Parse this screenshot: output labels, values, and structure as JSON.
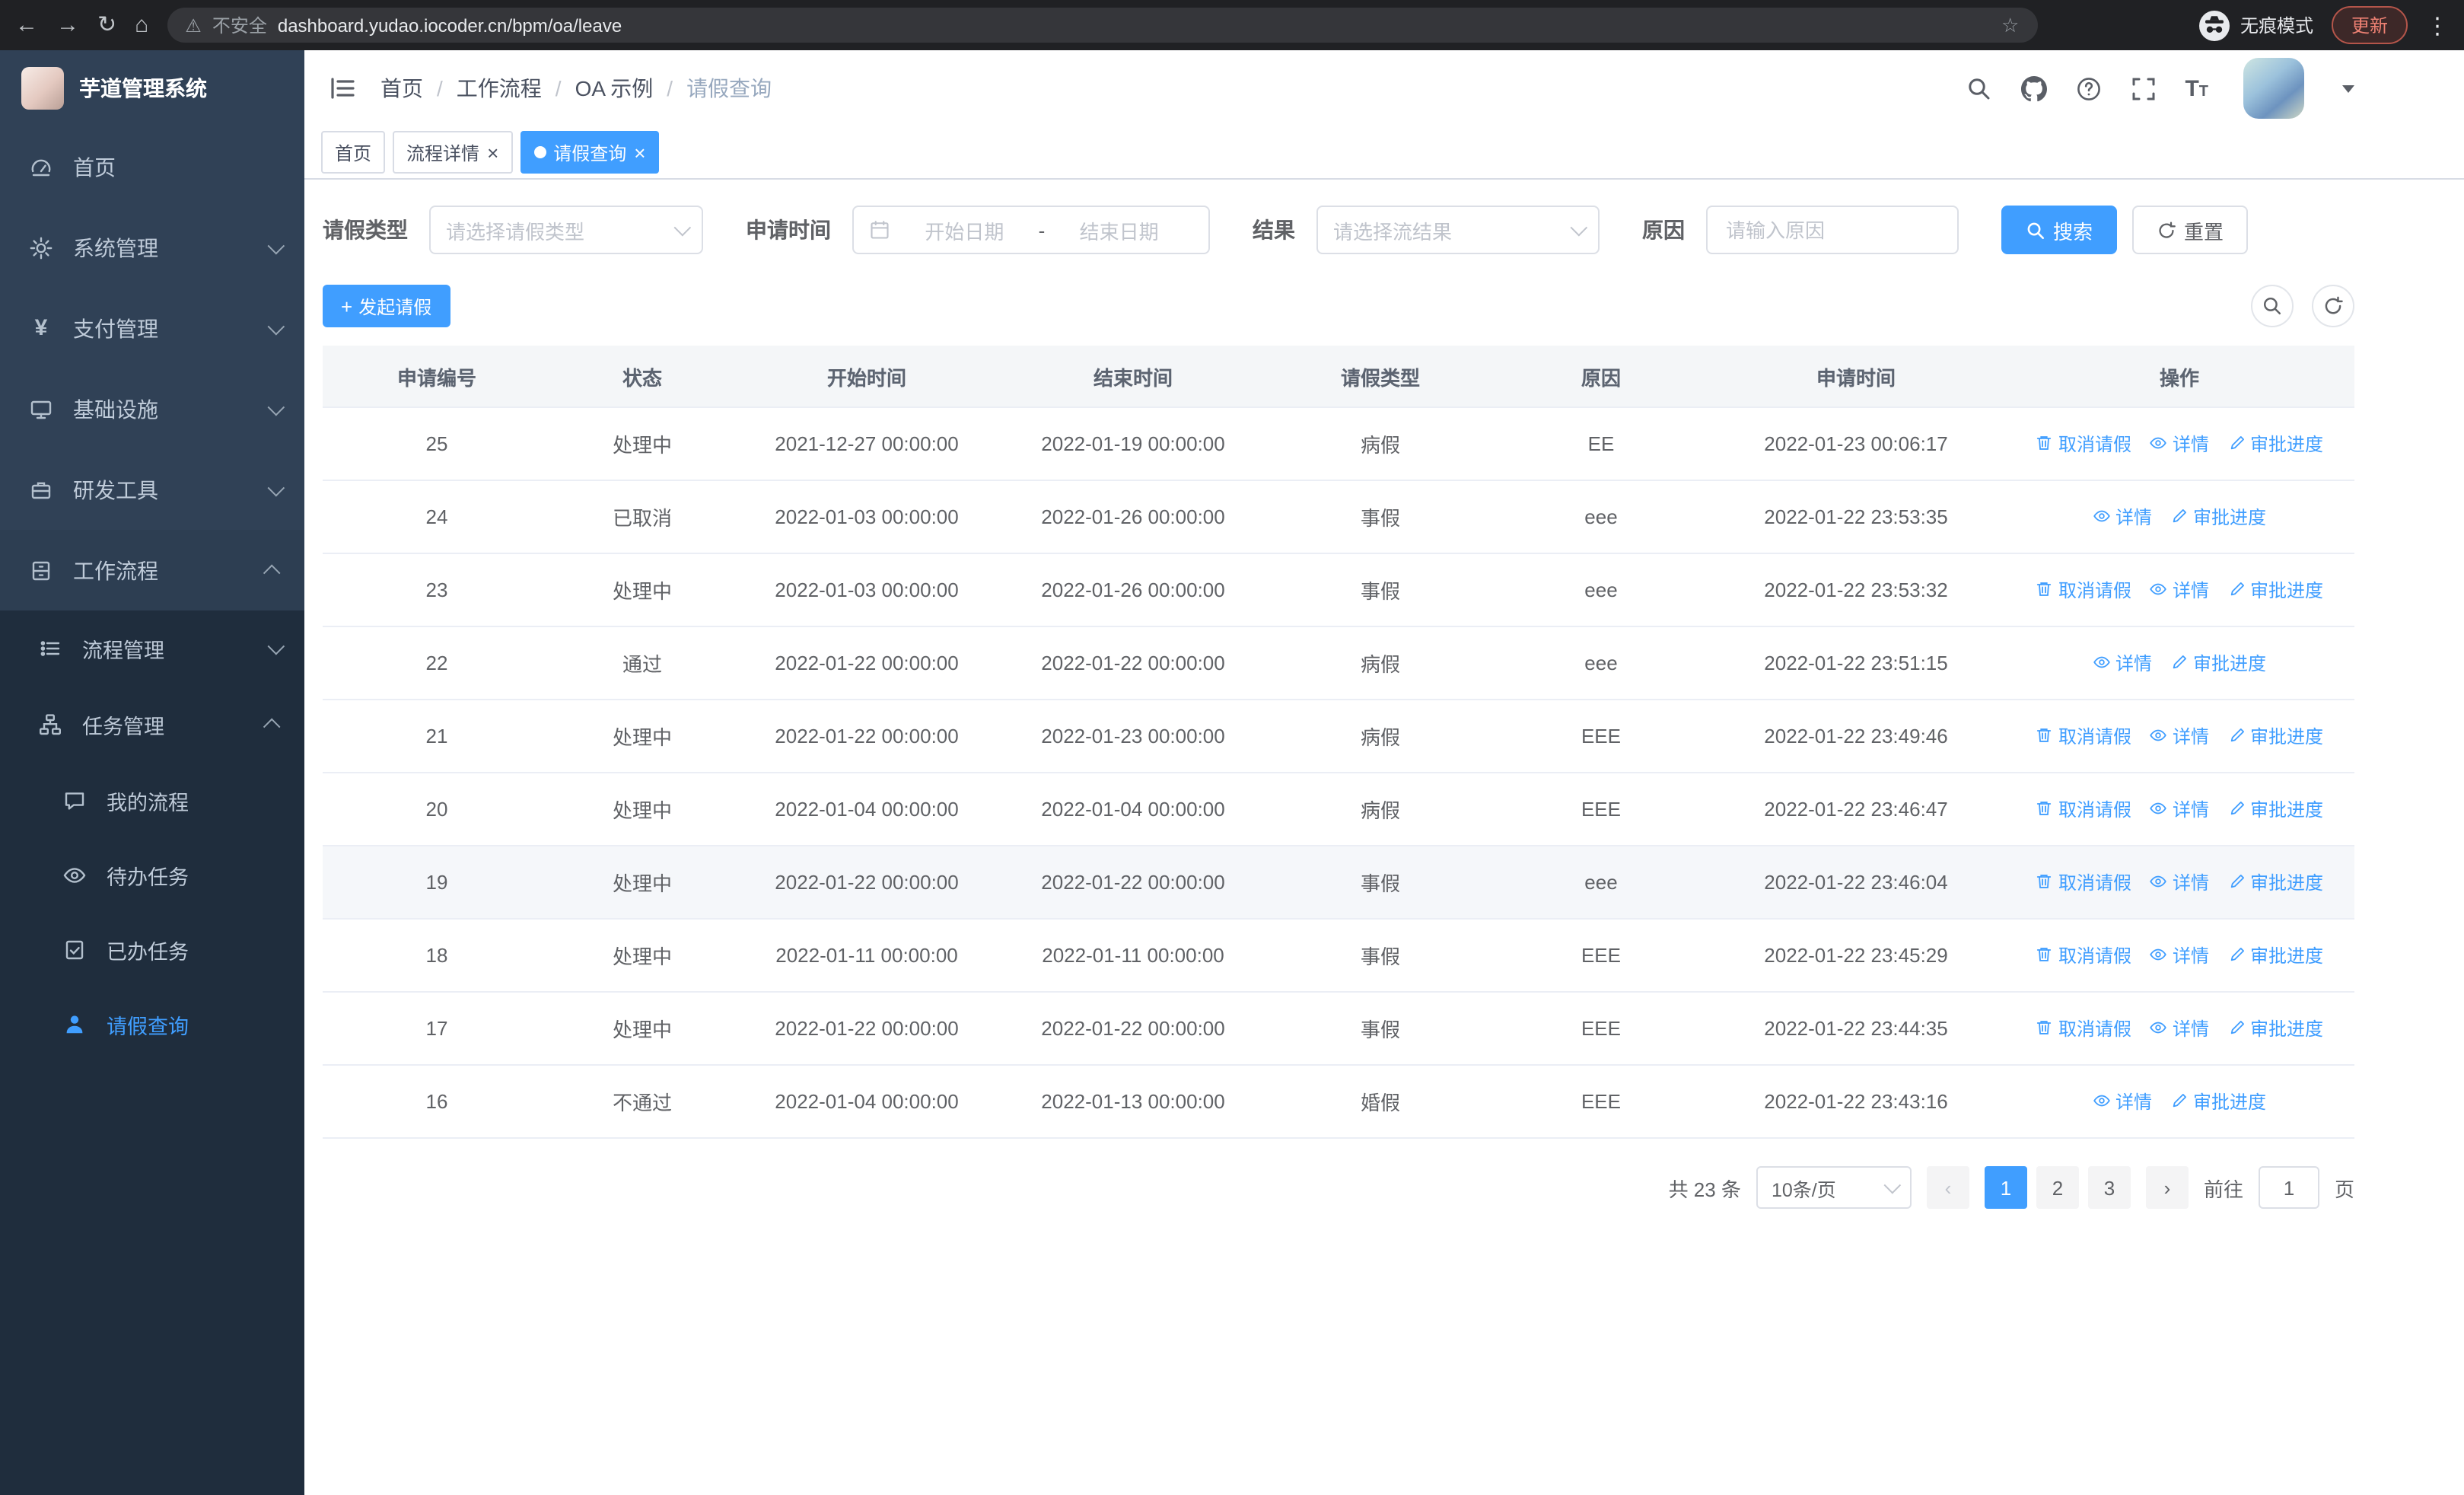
{
  "colors": {
    "primary": "#409eff",
    "sidebar_bg": "#304156",
    "submenu_bg": "#1f2d3d"
  },
  "icons": {
    "back": "←",
    "forward": "→",
    "reload": "↻",
    "home": "⌂",
    "warning": "⚠",
    "star": "☆",
    "menu_dots": "⋮",
    "close": "×",
    "plus": "+",
    "prev": "‹",
    "next": "›"
  },
  "browser": {
    "security_warning": "不安全",
    "url": "dashboard.yudao.iocoder.cn/bpm/oa/leave",
    "incognito_label": "无痕模式",
    "update_label": "更新"
  },
  "sidebar": {
    "logo_title": "芋道管理系统",
    "items": [
      {
        "label": "首页"
      },
      {
        "label": "系统管理"
      },
      {
        "label": "支付管理"
      },
      {
        "label": "基础设施"
      },
      {
        "label": "研发工具"
      },
      {
        "label": "工作流程"
      },
      {
        "label": "流程管理"
      },
      {
        "label": "任务管理"
      },
      {
        "label": "我的流程"
      },
      {
        "label": "待办任务"
      },
      {
        "label": "已办任务"
      },
      {
        "label": "请假查询"
      }
    ]
  },
  "breadcrumb": {
    "items": [
      "首页",
      "工作流程",
      "OA 示例",
      "请假查询"
    ]
  },
  "tabs": [
    {
      "label": "首页"
    },
    {
      "label": "流程详情",
      "closable": true
    },
    {
      "label": "请假查询",
      "closable": true,
      "active": true
    }
  ],
  "filters": {
    "leave_type_label": "请假类型",
    "leave_type_placeholder": "请选择请假类型",
    "apply_time_label": "申请时间",
    "start_date_placeholder": "开始日期",
    "date_separator": "-",
    "end_date_placeholder": "结束日期",
    "result_label": "结果",
    "result_placeholder": "请选择流结果",
    "reason_label": "原因",
    "reason_placeholder": "请输入原因",
    "search_label": "搜索",
    "reset_label": "重置"
  },
  "toolbar": {
    "create_label": "发起请假"
  },
  "table": {
    "headers": [
      "申请编号",
      "状态",
      "开始时间",
      "结束时间",
      "请假类型",
      "原因",
      "申请时间",
      "操作"
    ],
    "actions": {
      "cancel": "取消请假",
      "detail": "详情",
      "progress": "审批进度"
    },
    "rows": [
      {
        "id": "25",
        "status": "处理中",
        "start": "2021-12-27 00:00:00",
        "end": "2022-01-19 00:00:00",
        "type": "病假",
        "reason": "EE",
        "applied": "2022-01-23 00:06:17",
        "cancellable": true,
        "highlighted": false
      },
      {
        "id": "24",
        "status": "已取消",
        "start": "2022-01-03 00:00:00",
        "end": "2022-01-26 00:00:00",
        "type": "事假",
        "reason": "eee",
        "applied": "2022-01-22 23:53:35",
        "cancellable": false,
        "highlighted": false
      },
      {
        "id": "23",
        "status": "处理中",
        "start": "2022-01-03 00:00:00",
        "end": "2022-01-26 00:00:00",
        "type": "事假",
        "reason": "eee",
        "applied": "2022-01-22 23:53:32",
        "cancellable": true,
        "highlighted": false
      },
      {
        "id": "22",
        "status": "通过",
        "start": "2022-01-22 00:00:00",
        "end": "2022-01-22 00:00:00",
        "type": "病假",
        "reason": "eee",
        "applied": "2022-01-22 23:51:15",
        "cancellable": false,
        "highlighted": false
      },
      {
        "id": "21",
        "status": "处理中",
        "start": "2022-01-22 00:00:00",
        "end": "2022-01-23 00:00:00",
        "type": "病假",
        "reason": "EEE",
        "applied": "2022-01-22 23:49:46",
        "cancellable": true,
        "highlighted": false
      },
      {
        "id": "20",
        "status": "处理中",
        "start": "2022-01-04 00:00:00",
        "end": "2022-01-04 00:00:00",
        "type": "病假",
        "reason": "EEE",
        "applied": "2022-01-22 23:46:47",
        "cancellable": true,
        "highlighted": false
      },
      {
        "id": "19",
        "status": "处理中",
        "start": "2022-01-22 00:00:00",
        "end": "2022-01-22 00:00:00",
        "type": "事假",
        "reason": "eee",
        "applied": "2022-01-22 23:46:04",
        "cancellable": true,
        "highlighted": true
      },
      {
        "id": "18",
        "status": "处理中",
        "start": "2022-01-11 00:00:00",
        "end": "2022-01-11 00:00:00",
        "type": "事假",
        "reason": "EEE",
        "applied": "2022-01-22 23:45:29",
        "cancellable": true,
        "highlighted": false
      },
      {
        "id": "17",
        "status": "处理中",
        "start": "2022-01-22 00:00:00",
        "end": "2022-01-22 00:00:00",
        "type": "事假",
        "reason": "EEE",
        "applied": "2022-01-22 23:44:35",
        "cancellable": true,
        "highlighted": false
      },
      {
        "id": "16",
        "status": "不通过",
        "start": "2022-01-04 00:00:00",
        "end": "2022-01-13 00:00:00",
        "type": "婚假",
        "reason": "EEE",
        "applied": "2022-01-22 23:43:16",
        "cancellable": false,
        "highlighted": false
      }
    ]
  },
  "pagination": {
    "total_label": "共 23 条",
    "page_size": "10条/页",
    "pages": [
      "1",
      "2",
      "3"
    ],
    "active_page": "1",
    "goto_label": "前往",
    "goto_value": "1",
    "page_suffix": "页"
  }
}
